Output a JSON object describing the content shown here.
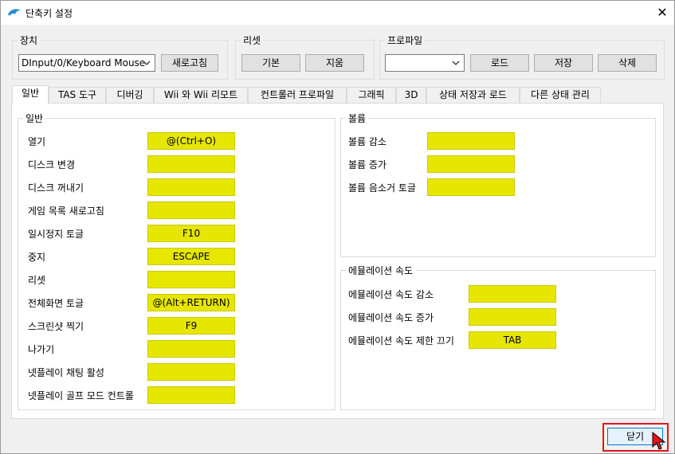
{
  "window": {
    "title": "단축키 설정"
  },
  "device": {
    "legend": "장치",
    "selected": "DInput/0/Keyboard Mouse",
    "refresh_label": "새로고침"
  },
  "reset": {
    "legend": "리셋",
    "default_label": "기본",
    "clear_label": "지움"
  },
  "profile": {
    "legend": "프로파일",
    "selected": "",
    "load_label": "로드",
    "save_label": "저장",
    "delete_label": "삭제"
  },
  "tabs": [
    {
      "label": "일반"
    },
    {
      "label": "TAS 도구"
    },
    {
      "label": "디버깅"
    },
    {
      "label": "Wii 와 Wii 리모트"
    },
    {
      "label": "컨트롤러 프로파일"
    },
    {
      "label": "그래픽"
    },
    {
      "label": "3D"
    },
    {
      "label": "상태 저장과 로드"
    },
    {
      "label": "다른 상태 관리"
    }
  ],
  "general": {
    "legend": "일반",
    "rows": [
      {
        "label": "열기",
        "value": "@(Ctrl+O)"
      },
      {
        "label": "디스크 변경",
        "value": ""
      },
      {
        "label": "디스크 꺼내기",
        "value": ""
      },
      {
        "label": "게임 목록 새로고침",
        "value": ""
      },
      {
        "label": "일시정지 토글",
        "value": "F10"
      },
      {
        "label": "중지",
        "value": "ESCAPE"
      },
      {
        "label": "리셋",
        "value": ""
      },
      {
        "label": "전체화면 토글",
        "value": "@(Alt+RETURN)"
      },
      {
        "label": "스크린샷 찍기",
        "value": "F9"
      },
      {
        "label": "나가기",
        "value": ""
      },
      {
        "label": "넷플레이 채팅 활성",
        "value": ""
      },
      {
        "label": "넷플레이 골프 모드 컨트롤",
        "value": ""
      }
    ]
  },
  "volume": {
    "legend": "볼륨",
    "rows": [
      {
        "label": "볼륨 감소",
        "value": ""
      },
      {
        "label": "볼륨 증가",
        "value": ""
      },
      {
        "label": "볼륨 음소거 토글",
        "value": ""
      }
    ]
  },
  "emulation_speed": {
    "legend": "에뮬레이션 속도",
    "rows": [
      {
        "label": "에뮬레이션 속도 감소",
        "value": ""
      },
      {
        "label": "에뮬레이션 속도 증가",
        "value": ""
      },
      {
        "label": "에뮬레이션 속도 제한 끄기",
        "value": "TAB"
      }
    ]
  },
  "footer": {
    "close_label": "닫기"
  },
  "colors": {
    "hotkey_field": "#e6e600",
    "highlight": "#e8141a"
  }
}
